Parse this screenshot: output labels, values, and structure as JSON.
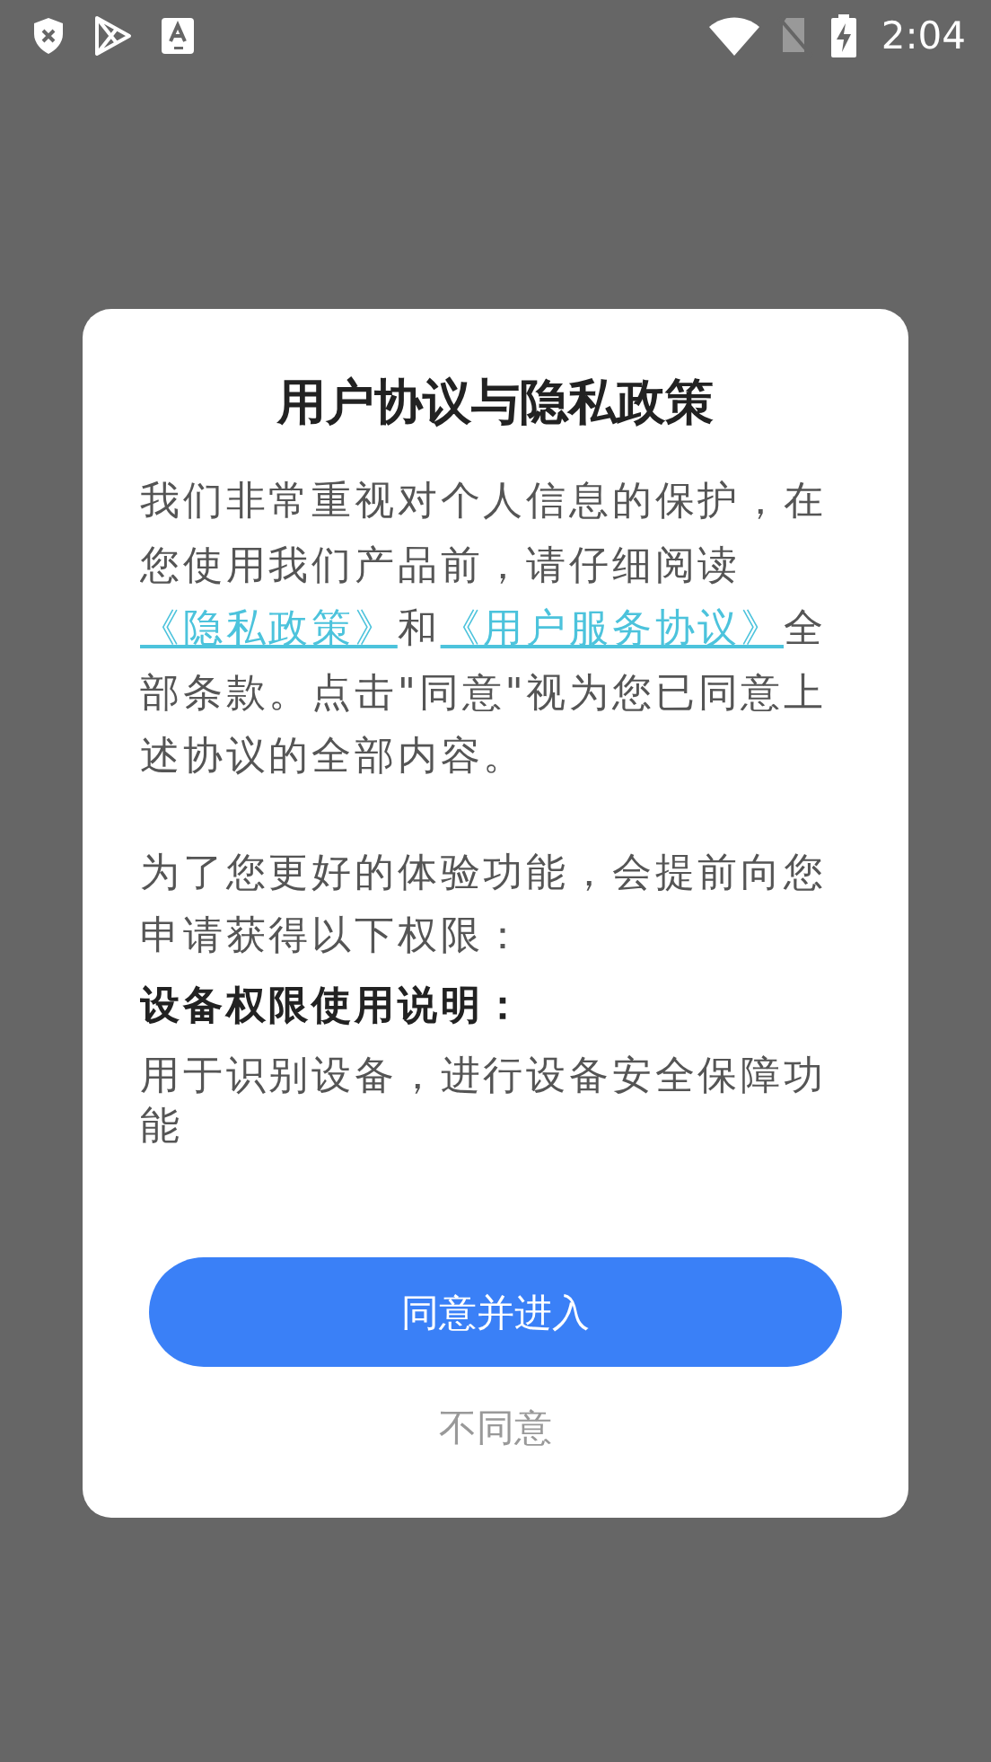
{
  "status_bar": {
    "time": "2:04"
  },
  "dialog": {
    "title": "用户协议与隐私政策",
    "intro": [
      {
        "kind": "text",
        "text": "我们非常重视对个人信息的保护，在您使用我们产品前，请仔细阅读"
      },
      {
        "kind": "link",
        "text": "《隐私政策》"
      },
      {
        "kind": "text",
        "text": "和"
      },
      {
        "kind": "link",
        "text": "《用户服务协议》"
      },
      {
        "kind": "text",
        "text": "全部条款。点击\"同意\"视为您已同意上述协议的全部内容。"
      }
    ],
    "notice": "为了您更好的体验功能，会提前向您申请获得以下权限：",
    "permissions": [
      {
        "heading": "设备权限使用说明：",
        "description": "用于识别设备，进行设备安全保障功能"
      }
    ],
    "agree_button": "同意并进入",
    "decline_button": "不同意"
  }
}
